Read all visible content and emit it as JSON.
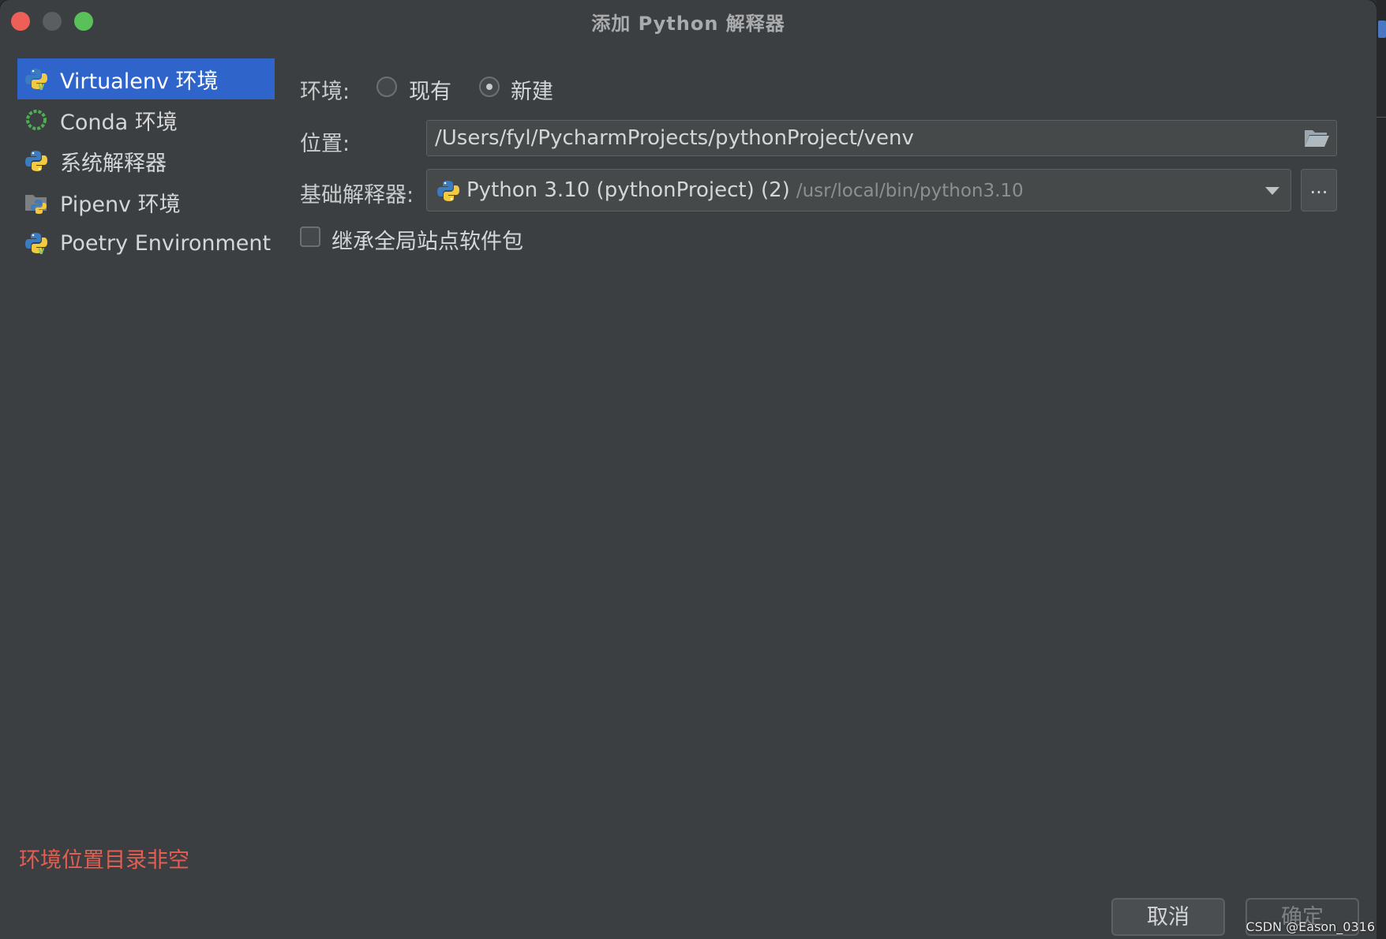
{
  "window": {
    "title": "添加 Python 解释器"
  },
  "sidebar": {
    "items": [
      {
        "label": "Virtualenv 环境",
        "icon": "python-virtualenv-icon",
        "selected": true
      },
      {
        "label": "Conda 环境",
        "icon": "conda-icon",
        "selected": false
      },
      {
        "label": "系统解释器",
        "icon": "python-icon",
        "selected": false
      },
      {
        "label": "Pipenv 环境",
        "icon": "pipenv-icon",
        "selected": false
      },
      {
        "label": "Poetry Environment",
        "icon": "poetry-icon",
        "selected": false
      }
    ]
  },
  "form": {
    "environment_label": "环境:",
    "option_existing": "现有",
    "option_new": "新建",
    "selected_option": "新建",
    "location_label": "位置:",
    "location_value": "/Users/fyl/PycharmProjects/pythonProject/venv",
    "base_interpreter_label": "基础解释器:",
    "base_interpreter_name": "Python 3.10 (pythonProject) (2)",
    "base_interpreter_path": "/usr/local/bin/python3.10",
    "more_button": "...",
    "inherit_label": "继承全局站点软件包",
    "inherit_checked": false
  },
  "error": {
    "message": "环境位置目录非空"
  },
  "footer": {
    "cancel_label": "取消",
    "ok_label": "确定"
  },
  "watermark": "CSDN @Eason_0316",
  "colors": {
    "accent": "#2f65ca",
    "error": "#e65d51",
    "background": "#3c3f41"
  }
}
